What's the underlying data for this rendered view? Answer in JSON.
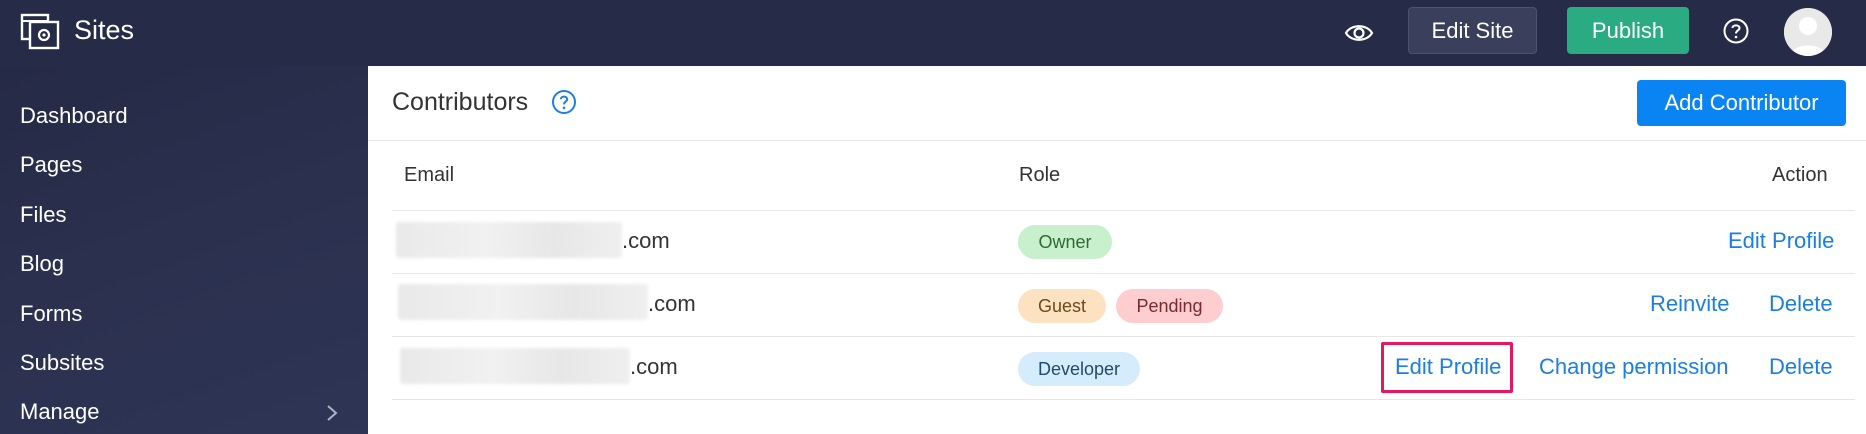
{
  "header": {
    "app_title": "Sites",
    "edit_site_label": "Edit Site",
    "publish_label": "Publish"
  },
  "sidebar": {
    "items": [
      {
        "label": "Dashboard"
      },
      {
        "label": "Pages"
      },
      {
        "label": "Files"
      },
      {
        "label": "Blog"
      },
      {
        "label": "Forms"
      },
      {
        "label": "Subsites"
      },
      {
        "label": "Manage"
      }
    ]
  },
  "main": {
    "title": "Contributors",
    "add_button_label": "Add Contributor",
    "columns": {
      "email": "Email",
      "role": "Role",
      "action": "Action"
    },
    "rows": [
      {
        "email_suffix": ".com",
        "roles": [
          "Owner"
        ],
        "actions": [
          "Edit Profile"
        ]
      },
      {
        "email_suffix": ".com",
        "roles": [
          "Guest",
          "Pending"
        ],
        "actions": [
          "Reinvite",
          "Delete"
        ]
      },
      {
        "email_suffix": ".com",
        "roles": [
          "Developer"
        ],
        "actions": [
          "Edit Profile",
          "Change permission",
          "Delete"
        ]
      }
    ]
  },
  "colors": {
    "topbar_bg": "#262b48",
    "publish_green": "#2bab82",
    "primary_blue": "#0a84f3",
    "link_blue": "#1a7fe0",
    "highlight_pink": "#e8175d"
  },
  "icons": [
    "sites-logo-icon",
    "eye-icon",
    "help-icon",
    "avatar",
    "chevron-right-icon"
  ]
}
